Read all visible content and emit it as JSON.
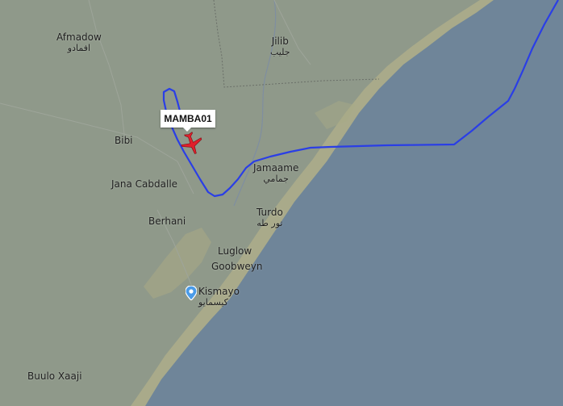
{
  "flight": {
    "callsign": "MAMBA01"
  },
  "colors": {
    "land": "#8f998a",
    "sea": "#6f8599",
    "coast_sand": "#b2b08a",
    "track": "#2a3ee6",
    "aircraft": "#e01f2b"
  },
  "icons": {
    "aircraft": "airplane-icon",
    "location": "location-pin-icon"
  },
  "places": {
    "afmadow": {
      "name": "Afmadow",
      "alt": "افمادو"
    },
    "jilib": {
      "name": "Jilib",
      "alt": "جليب"
    },
    "bibi": {
      "name": "Bibi"
    },
    "jamaame": {
      "name": "Jamaame",
      "alt": "جمامي"
    },
    "jana_cabdalle": {
      "name": "Jana Cabdalle"
    },
    "turdo": {
      "name": "Turdo",
      "alt": "تور طه"
    },
    "berhani": {
      "name": "Berhani"
    },
    "luglow": {
      "name": "Luglow"
    },
    "goobweyn": {
      "name": "Goobweyn"
    },
    "kismayo": {
      "name": "Kismayo",
      "alt": "كيسمايو"
    },
    "buulo_xaaji": {
      "name": "Buulo Xaaji"
    }
  }
}
